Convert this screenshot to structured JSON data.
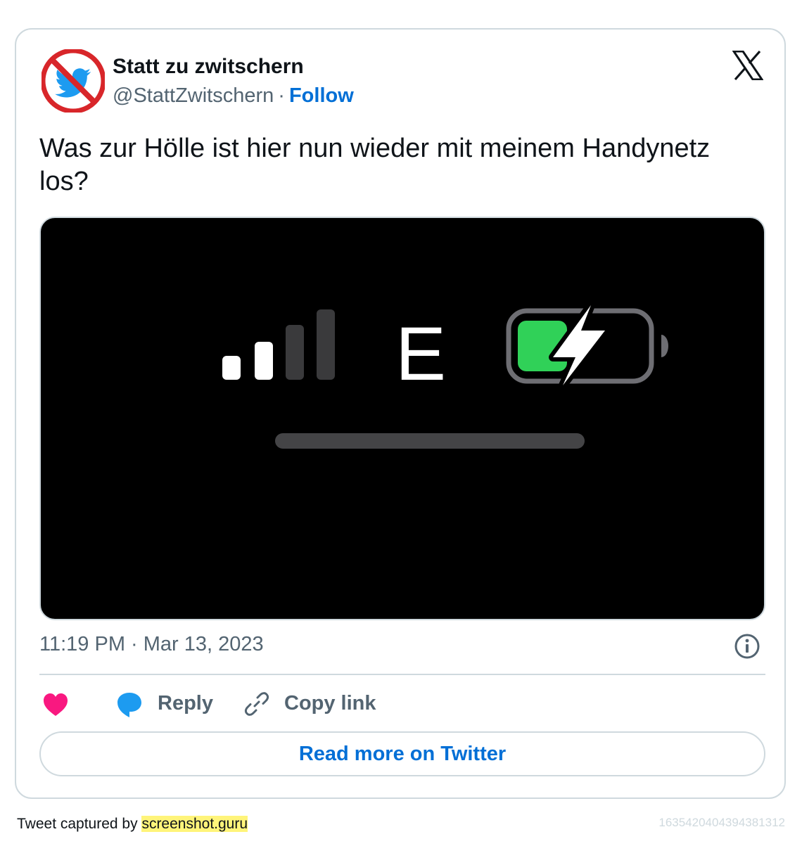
{
  "author": {
    "name": "Statt zu zwitschern",
    "handle": "@StattZwitschern",
    "separator": "·",
    "follow_label": "Follow",
    "avatar_icon": "no-twitter-bird-icon"
  },
  "tweet": {
    "text": "Was zur Hölle ist hier nun wieder mit meinem Handynetz los?",
    "timestamp": "11:19 PM · Mar 13, 2023",
    "media": {
      "network_type": "E",
      "signal_bars_active": 2,
      "signal_bars_total": 4,
      "battery_charging": true,
      "battery_level": 0.3,
      "battery_color": "#30d158"
    }
  },
  "actions": {
    "like_icon": "heart-icon",
    "reply_label": "Reply",
    "copy_label": "Copy link"
  },
  "read_more_label": "Read more on Twitter",
  "footer": {
    "captured_by": "Tweet captured by ",
    "site": "screenshot.guru",
    "tweet_id": "1635420404394381312"
  },
  "colors": {
    "link": "#006fd6",
    "like": "#f91880",
    "reply": "#1d9bf0",
    "muted": "#536471",
    "border": "#cfd9de"
  }
}
